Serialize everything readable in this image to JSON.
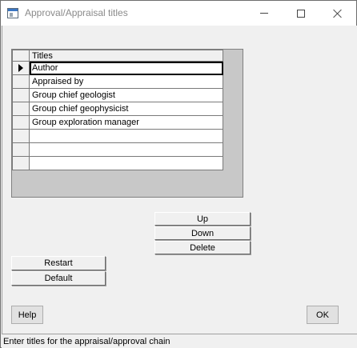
{
  "window": {
    "title": "Approval/Appraisal titles"
  },
  "grid": {
    "column_header": "Titles",
    "rows": [
      "Author",
      "Appraised by",
      "Group chief geologist",
      "Group chief geophysicist",
      "Group exploration manager",
      "",
      "",
      ""
    ],
    "current_row": 0
  },
  "buttons": {
    "up": "Up",
    "down": "Down",
    "delete": "Delete",
    "restart": "Restart",
    "default": "Default",
    "help": "Help",
    "ok": "OK"
  },
  "status": {
    "text": "Enter titles for the appraisal/approval chain"
  },
  "icons": {
    "app": "window-icon",
    "minimize": "minimize-icon",
    "maximize": "maximize-icon",
    "close": "close-icon",
    "row_pointer": "row-pointer-icon"
  }
}
